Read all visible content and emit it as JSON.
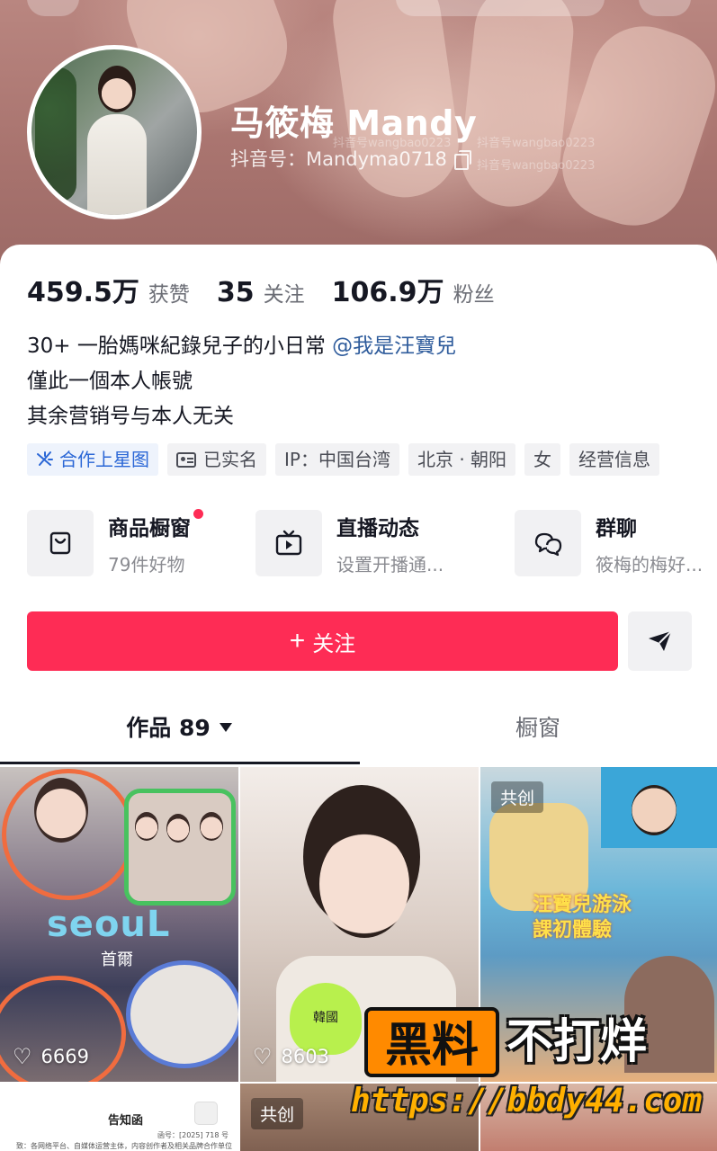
{
  "profile": {
    "name": "马筱梅 Mandy",
    "douyin_id": "抖音号：Mandyma0718",
    "watermark": "抖音号wangbao0223"
  },
  "stats": [
    {
      "value": "459.5万",
      "label": "获赞"
    },
    {
      "value": "35",
      "label": "关注"
    },
    {
      "value": "106.9万",
      "label": "粉丝"
    }
  ],
  "bio": {
    "line1_text": "30+ 一胎媽咪紀錄兒子的小日常 ",
    "line1_mention": "@我是汪寶兒",
    "line2": "僅此一個本人帳號",
    "line3": "其余营销号与本人无关"
  },
  "tags": {
    "star": "合作上星图",
    "verified": "已实名",
    "ip": "IP：中国台湾",
    "location": "北京 · 朝阳",
    "gender": "女",
    "business": "经营信息"
  },
  "features": {
    "shop": {
      "title": "商品橱窗",
      "subtitle": "79件好物"
    },
    "live": {
      "title": "直播动态",
      "subtitle": "设置开播通..."
    },
    "group": {
      "title": "群聊",
      "subtitle": "筱梅的梅好..."
    }
  },
  "actions": {
    "follow_plus": "+",
    "follow_label": "关注"
  },
  "tabs": {
    "works": "作品 89",
    "shop": "橱窗"
  },
  "videos": [
    {
      "likes": "6669",
      "overlay_title": "seouL",
      "overlay_sub": "首爾",
      "collab": ""
    },
    {
      "likes": "8603",
      "overlay_title": "韓國",
      "collab": ""
    },
    {
      "likes": "",
      "overlay_title": "汪寶兒游泳\n課初體驗",
      "collab": "共创"
    },
    {
      "notice_title": "告知函",
      "notice_no": "函号：[2025] 718 号",
      "notice_body": "致：各网络平台、自媒体运营主体，内容创作者及相关品牌合作单位"
    },
    {
      "collab": "共创"
    }
  ],
  "ad": {
    "black_label": "黑料",
    "rest_label": "不打烊",
    "url": "https://bbdy44.com"
  },
  "colors": {
    "accent": "#fe2c55",
    "link": "#2f5c9c",
    "star_tag": "#2b67d6"
  }
}
